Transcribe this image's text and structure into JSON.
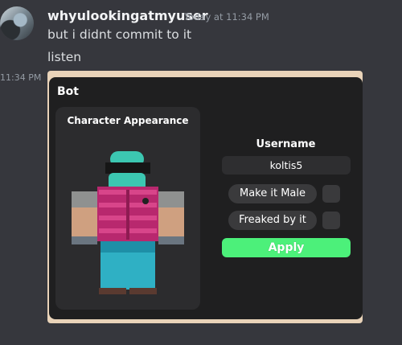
{
  "message": {
    "username": "whyulookingatmyuser",
    "timestamp": "Today at 11:34 PM",
    "lines": [
      "but i didnt commit to it",
      "listen"
    ],
    "side_time": "11:34 PM"
  },
  "panel": {
    "title": "Bot",
    "character_card_title": "Character Appearance",
    "username_label": "Username",
    "username_value": "koltis5",
    "option1_label": "Make it Male",
    "option2_label": "Freaked by it",
    "apply_label": "Apply"
  },
  "colors": {
    "background": "#36373d",
    "panel": "#1f1f20",
    "apply_button": "#4cf07a"
  }
}
